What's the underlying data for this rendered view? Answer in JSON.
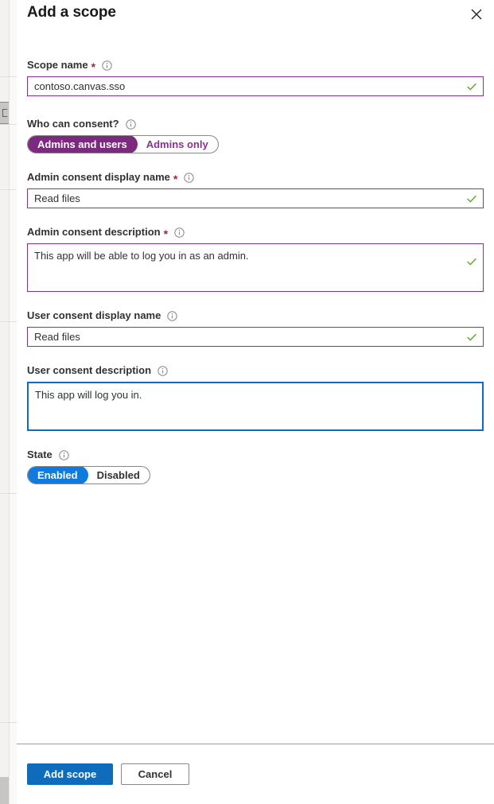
{
  "panel": {
    "title": "Add a scope",
    "close_icon": "close-icon"
  },
  "fields": {
    "scope_name": {
      "label": "Scope name",
      "required": true,
      "info_icon": "info-icon",
      "value": "contoso.canvas.sso",
      "valid_icon": "checkmark-icon"
    },
    "who_can_consent": {
      "label": "Who can consent?",
      "required": false,
      "info_icon": "info-icon",
      "options": [
        "Admins and users",
        "Admins only"
      ],
      "selected": "Admins and users"
    },
    "admin_consent_display_name": {
      "label": "Admin consent display name",
      "required": true,
      "info_icon": "info-icon",
      "value": "Read files",
      "valid_icon": "checkmark-icon"
    },
    "admin_consent_description": {
      "label": "Admin consent description",
      "required": true,
      "info_icon": "info-icon",
      "value": "This app will be able to log you in as an admin.",
      "valid_icon": "checkmark-icon"
    },
    "user_consent_display_name": {
      "label": "User consent display name",
      "required": false,
      "info_icon": "info-icon",
      "value": "Read files",
      "valid_icon": "checkmark-icon"
    },
    "user_consent_description": {
      "label": "User consent description",
      "required": false,
      "info_icon": "info-icon",
      "value": "This app will log you in.",
      "focused": true
    },
    "state": {
      "label": "State",
      "required": false,
      "info_icon": "info-icon",
      "options": [
        "Enabled",
        "Disabled"
      ],
      "selected": "Enabled"
    }
  },
  "footer": {
    "primary_label": "Add scope",
    "secondary_label": "Cancel"
  },
  "colors": {
    "purple_accent": "#7b2a80",
    "purple_border": "#8a2f93",
    "blue_accent": "#0f7ae0",
    "blue_primary": "#0f6cbd",
    "green_valid": "#107c10",
    "required_red": "#a4262c",
    "text": "#323130"
  }
}
